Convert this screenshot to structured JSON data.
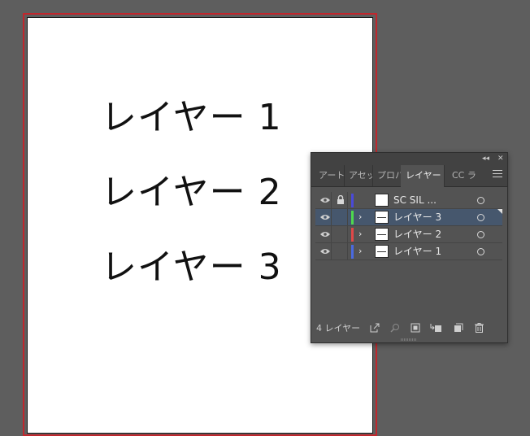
{
  "artboard": {
    "texts": [
      "レイヤー 1",
      "レイヤー 2",
      "レイヤー 3"
    ]
  },
  "panel": {
    "collapse_glyph": "◂◂",
    "close_glyph": "✕",
    "tabs": [
      {
        "label": "アート",
        "active": false
      },
      {
        "label": "アセッ",
        "active": false
      },
      {
        "label": "プロパ",
        "active": false
      },
      {
        "label": "レイヤー",
        "active": true
      },
      {
        "label": "CC ラ",
        "active": false
      }
    ],
    "layers": [
      {
        "name": "SC SIL ...",
        "color": "#4a4ad8",
        "locked": true,
        "expandable": false,
        "selected": false
      },
      {
        "name": "レイヤー 3",
        "color": "#4ed94e",
        "locked": false,
        "expandable": true,
        "selected": true
      },
      {
        "name": "レイヤー 2",
        "color": "#e04848",
        "locked": false,
        "expandable": true,
        "selected": false
      },
      {
        "name": "レイヤー 1",
        "color": "#4a6ae0",
        "locked": false,
        "expandable": true,
        "selected": false
      }
    ],
    "layer_count": "4 レイヤー",
    "chevron_glyph": "›"
  },
  "colors": {
    "canvas_bg": "#5e5e5e",
    "artboard_border": "#c0272d",
    "selection": "#46576d"
  }
}
